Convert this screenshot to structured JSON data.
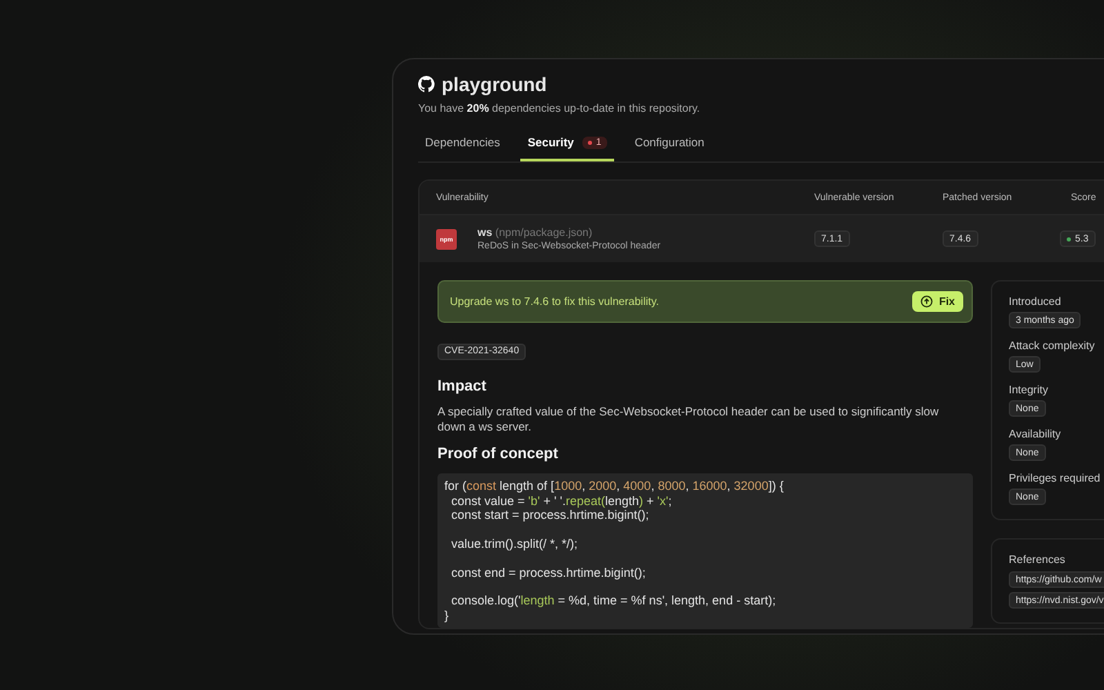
{
  "repo": {
    "name": "playground",
    "summary": "You have **20%** dependencies up-to-date in this repository."
  },
  "tabs": [
    {
      "label": "Dependencies",
      "selected": false
    },
    {
      "label": "Security",
      "selected": true,
      "badge": {
        "count": "1",
        "color": "#e5484d"
      }
    },
    {
      "label": "Configuration",
      "selected": false
    }
  ],
  "table": {
    "columns": [
      "Vulnerability",
      "Vulnerable version",
      "Patched version",
      "Score"
    ],
    "rows": [
      {
        "registry": "npm",
        "package": "ws",
        "manifest": "(npm/package.json)",
        "title": "ReDoS in Sec-Websocket-Protocol header",
        "vulnerable_version": "7.1.1",
        "patched_version": "7.4.6",
        "score": {
          "value": "5.3",
          "color": "#46a758"
        }
      }
    ]
  },
  "detail": {
    "banner": "Upgrade ws to 7.4.6 to fix this vulnerability.",
    "fix_button": "Fix",
    "cve": "CVE-2021-32640",
    "sections": [
      {
        "heading": "Impact",
        "body": "A specially crafted value of the Sec-Websocket-Protocol header can be used to significantly slow down a ws server."
      },
      {
        "heading": "Proof of concept"
      }
    ],
    "code": [
      {
        "kind": "code",
        "tokens": [
          {
            "kind": "plain",
            "text": "for ("
          },
          {
            "kind": "keyword",
            "text": "const"
          },
          {
            "kind": "plain",
            "text": " length of ["
          },
          {
            "kind": "number",
            "text": "1000"
          },
          {
            "kind": "plain",
            "text": ", "
          },
          {
            "kind": "number",
            "text": "2000"
          },
          {
            "kind": "plain",
            "text": ", "
          },
          {
            "kind": "number",
            "text": "4000"
          },
          {
            "kind": "plain",
            "text": ", "
          },
          {
            "kind": "number",
            "text": "8000"
          },
          {
            "kind": "plain",
            "text": ", "
          },
          {
            "kind": "number",
            "text": "16000"
          },
          {
            "kind": "plain",
            "text": ", "
          },
          {
            "kind": "number",
            "text": "32000"
          },
          {
            "kind": "plain",
            "text": "]) {"
          }
        ]
      },
      {
        "kind": "code",
        "tokens": [
          {
            "kind": "plain",
            "text": "  const value = "
          },
          {
            "kind": "string",
            "text": "'b'"
          },
          {
            "kind": "plain",
            "text": " + ' '."
          },
          {
            "kind": "method",
            "text": "repeat("
          },
          {
            "kind": "plain",
            "text": "length"
          },
          {
            "kind": "method",
            "text": ")"
          },
          {
            "kind": "plain",
            "text": " + "
          },
          {
            "kind": "string",
            "text": "'x'"
          },
          {
            "kind": "plain",
            "text": ";"
          }
        ]
      },
      {
        "kind": "code",
        "tokens": [
          {
            "kind": "plain",
            "text": "  const start = process.hrtime.bigint();"
          }
        ]
      },
      {
        "kind": "blank"
      },
      {
        "kind": "code",
        "tokens": [
          {
            "kind": "plain",
            "text": "  value.trim().split(/ *, */);"
          }
        ]
      },
      {
        "kind": "blank"
      },
      {
        "kind": "code",
        "tokens": [
          {
            "kind": "plain",
            "text": "  const end = process.hrtime.bigint();"
          }
        ]
      },
      {
        "kind": "blank"
      },
      {
        "kind": "code",
        "tokens": [
          {
            "kind": "plain",
            "text": "  console.log('"
          },
          {
            "kind": "string",
            "text": "length"
          },
          {
            "kind": "plain",
            "text": " = %d, time = %f ns', length, end - start);"
          }
        ]
      },
      {
        "kind": "code",
        "tokens": [
          {
            "kind": "plain",
            "text": "}"
          }
        ]
      }
    ]
  },
  "sidebar": {
    "facts": [
      {
        "label": "Introduced",
        "value": "3 months ago"
      },
      {
        "label": "Attack complexity",
        "value": "Low"
      },
      {
        "label": "Integrity",
        "value": "None"
      },
      {
        "label": "Availability",
        "value": "None"
      },
      {
        "label": "Privileges required",
        "value": "None"
      }
    ],
    "references_label": "References",
    "references": [
      "https://github.com/w",
      "https://nvd.nist.gov/v"
    ]
  }
}
